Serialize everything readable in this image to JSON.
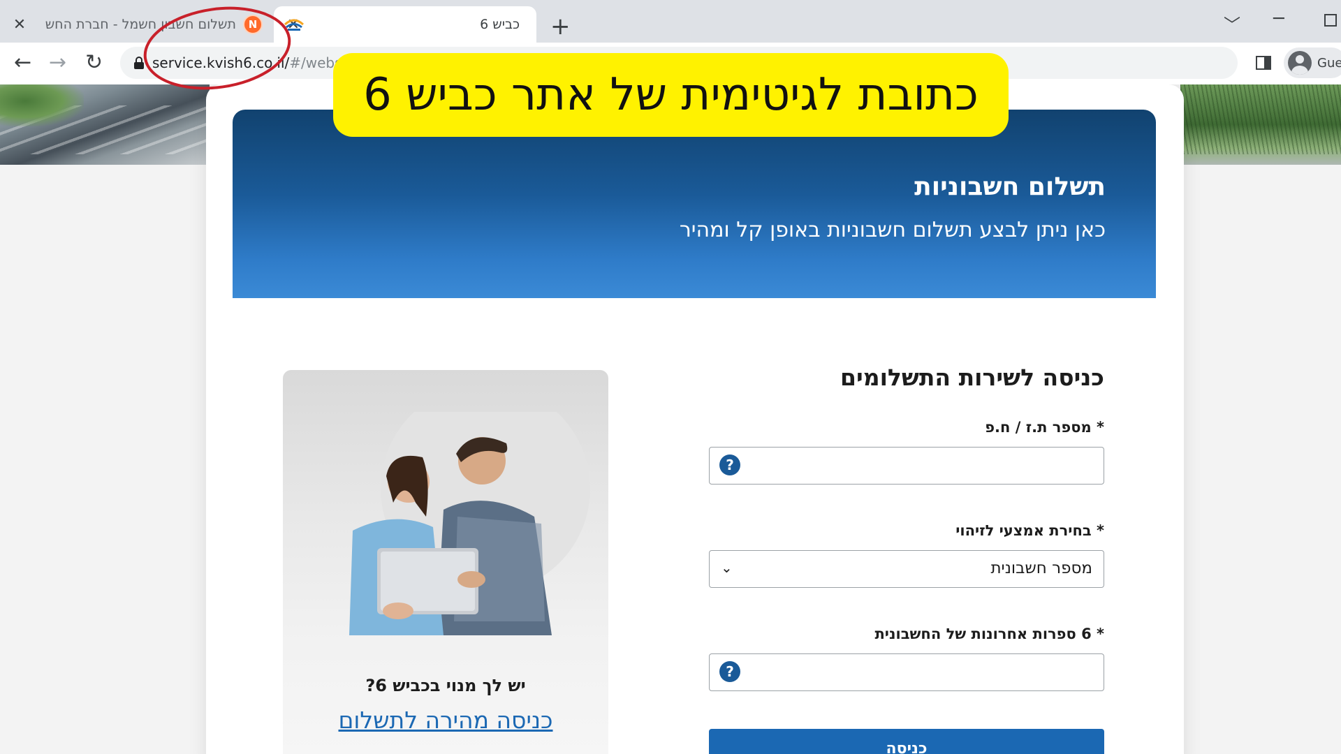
{
  "browser": {
    "tabs": [
      {
        "title": "תשלום חשבון חשמל - חברת החש",
        "favicon": "electric-company-icon",
        "active": false
      },
      {
        "title": "כביש 6",
        "favicon": "kvish6-logo-icon",
        "active": true
      }
    ],
    "new_tab_symbol": "+",
    "close_symbol": "✕",
    "url_host": "service.kvish6.co.il/",
    "url_path": "#/websi",
    "profile_label": "Gue"
  },
  "banner": {
    "title": "תשלום חשבוניות",
    "subtitle": "כאן ניתן לבצע תשלום חשבוניות באופן קל ומהיר"
  },
  "form": {
    "title": "כניסה לשירות התשלומים",
    "id_label": "* מספר ת.ז / ח.פ",
    "id_placeholder": "",
    "method_label": "* בחירת אמצעי לזיהוי",
    "method_value": "מספר חשבונית",
    "digits_label": "* 6 ספרות אחרונות של החשבונית",
    "digits_placeholder": "",
    "help_symbol": "?",
    "submit_label": "כניסה"
  },
  "promo": {
    "question": "יש לך מנוי בכביש 6?",
    "link": "כניסה מהירה לתשלום"
  },
  "overlay": {
    "text": "כתובת לגיטימית של אתר כביש 6",
    "background": "#fff200",
    "circle_color": "#c8202a"
  },
  "colors": {
    "brand_blue": "#1b68b3",
    "banner_dark": "#11426f"
  }
}
